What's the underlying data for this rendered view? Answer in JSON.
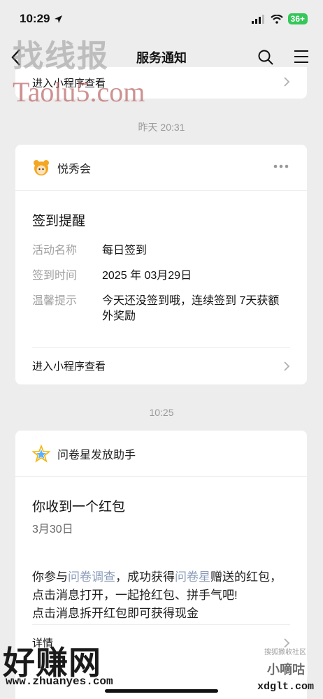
{
  "status": {
    "time": "10:29",
    "battery": "36+"
  },
  "nav": {
    "title": "服务通知"
  },
  "top_card": {
    "link": "进入小程序查看"
  },
  "sep1": "昨天 20:31",
  "card1": {
    "app_name": "悦秀会",
    "title": "签到提醒",
    "rows": [
      {
        "label": "活动名称",
        "value": "每日签到"
      },
      {
        "label": "签到时间",
        "value": "2025 年 03月29日"
      },
      {
        "label": "温馨提示",
        "value": "今天还没签到哦，连续签到 7天获额外奖励"
      }
    ],
    "link": "进入小程序查看"
  },
  "sep2": "10:25",
  "card2": {
    "app_name": "问卷星发放助手",
    "title": "你收到一个红包",
    "date": "3月30日",
    "body_p1": "你参与",
    "body_h1": "问卷调查",
    "body_p2": "，成功获得",
    "body_h2": "问卷星",
    "body_p3": "赠送的红包，点击消息打开，一起抢红包、拼手气吧!",
    "body_p4": "点击消息拆开红包即可获得现金",
    "link": "详情"
  },
  "watermarks": {
    "top_cn": "找线报",
    "top_en": "Taolu5.com",
    "bottom_cn": "好赚网",
    "bottom_url": "www.zhuanyes.com",
    "br_small": "搜狐撒收社区",
    "br_big": "小嘀咕",
    "br_url": "xdglt.com"
  },
  "colors": {
    "highlight": "#8a9bb8",
    "background": "#ededed",
    "battery": "#34c759"
  }
}
